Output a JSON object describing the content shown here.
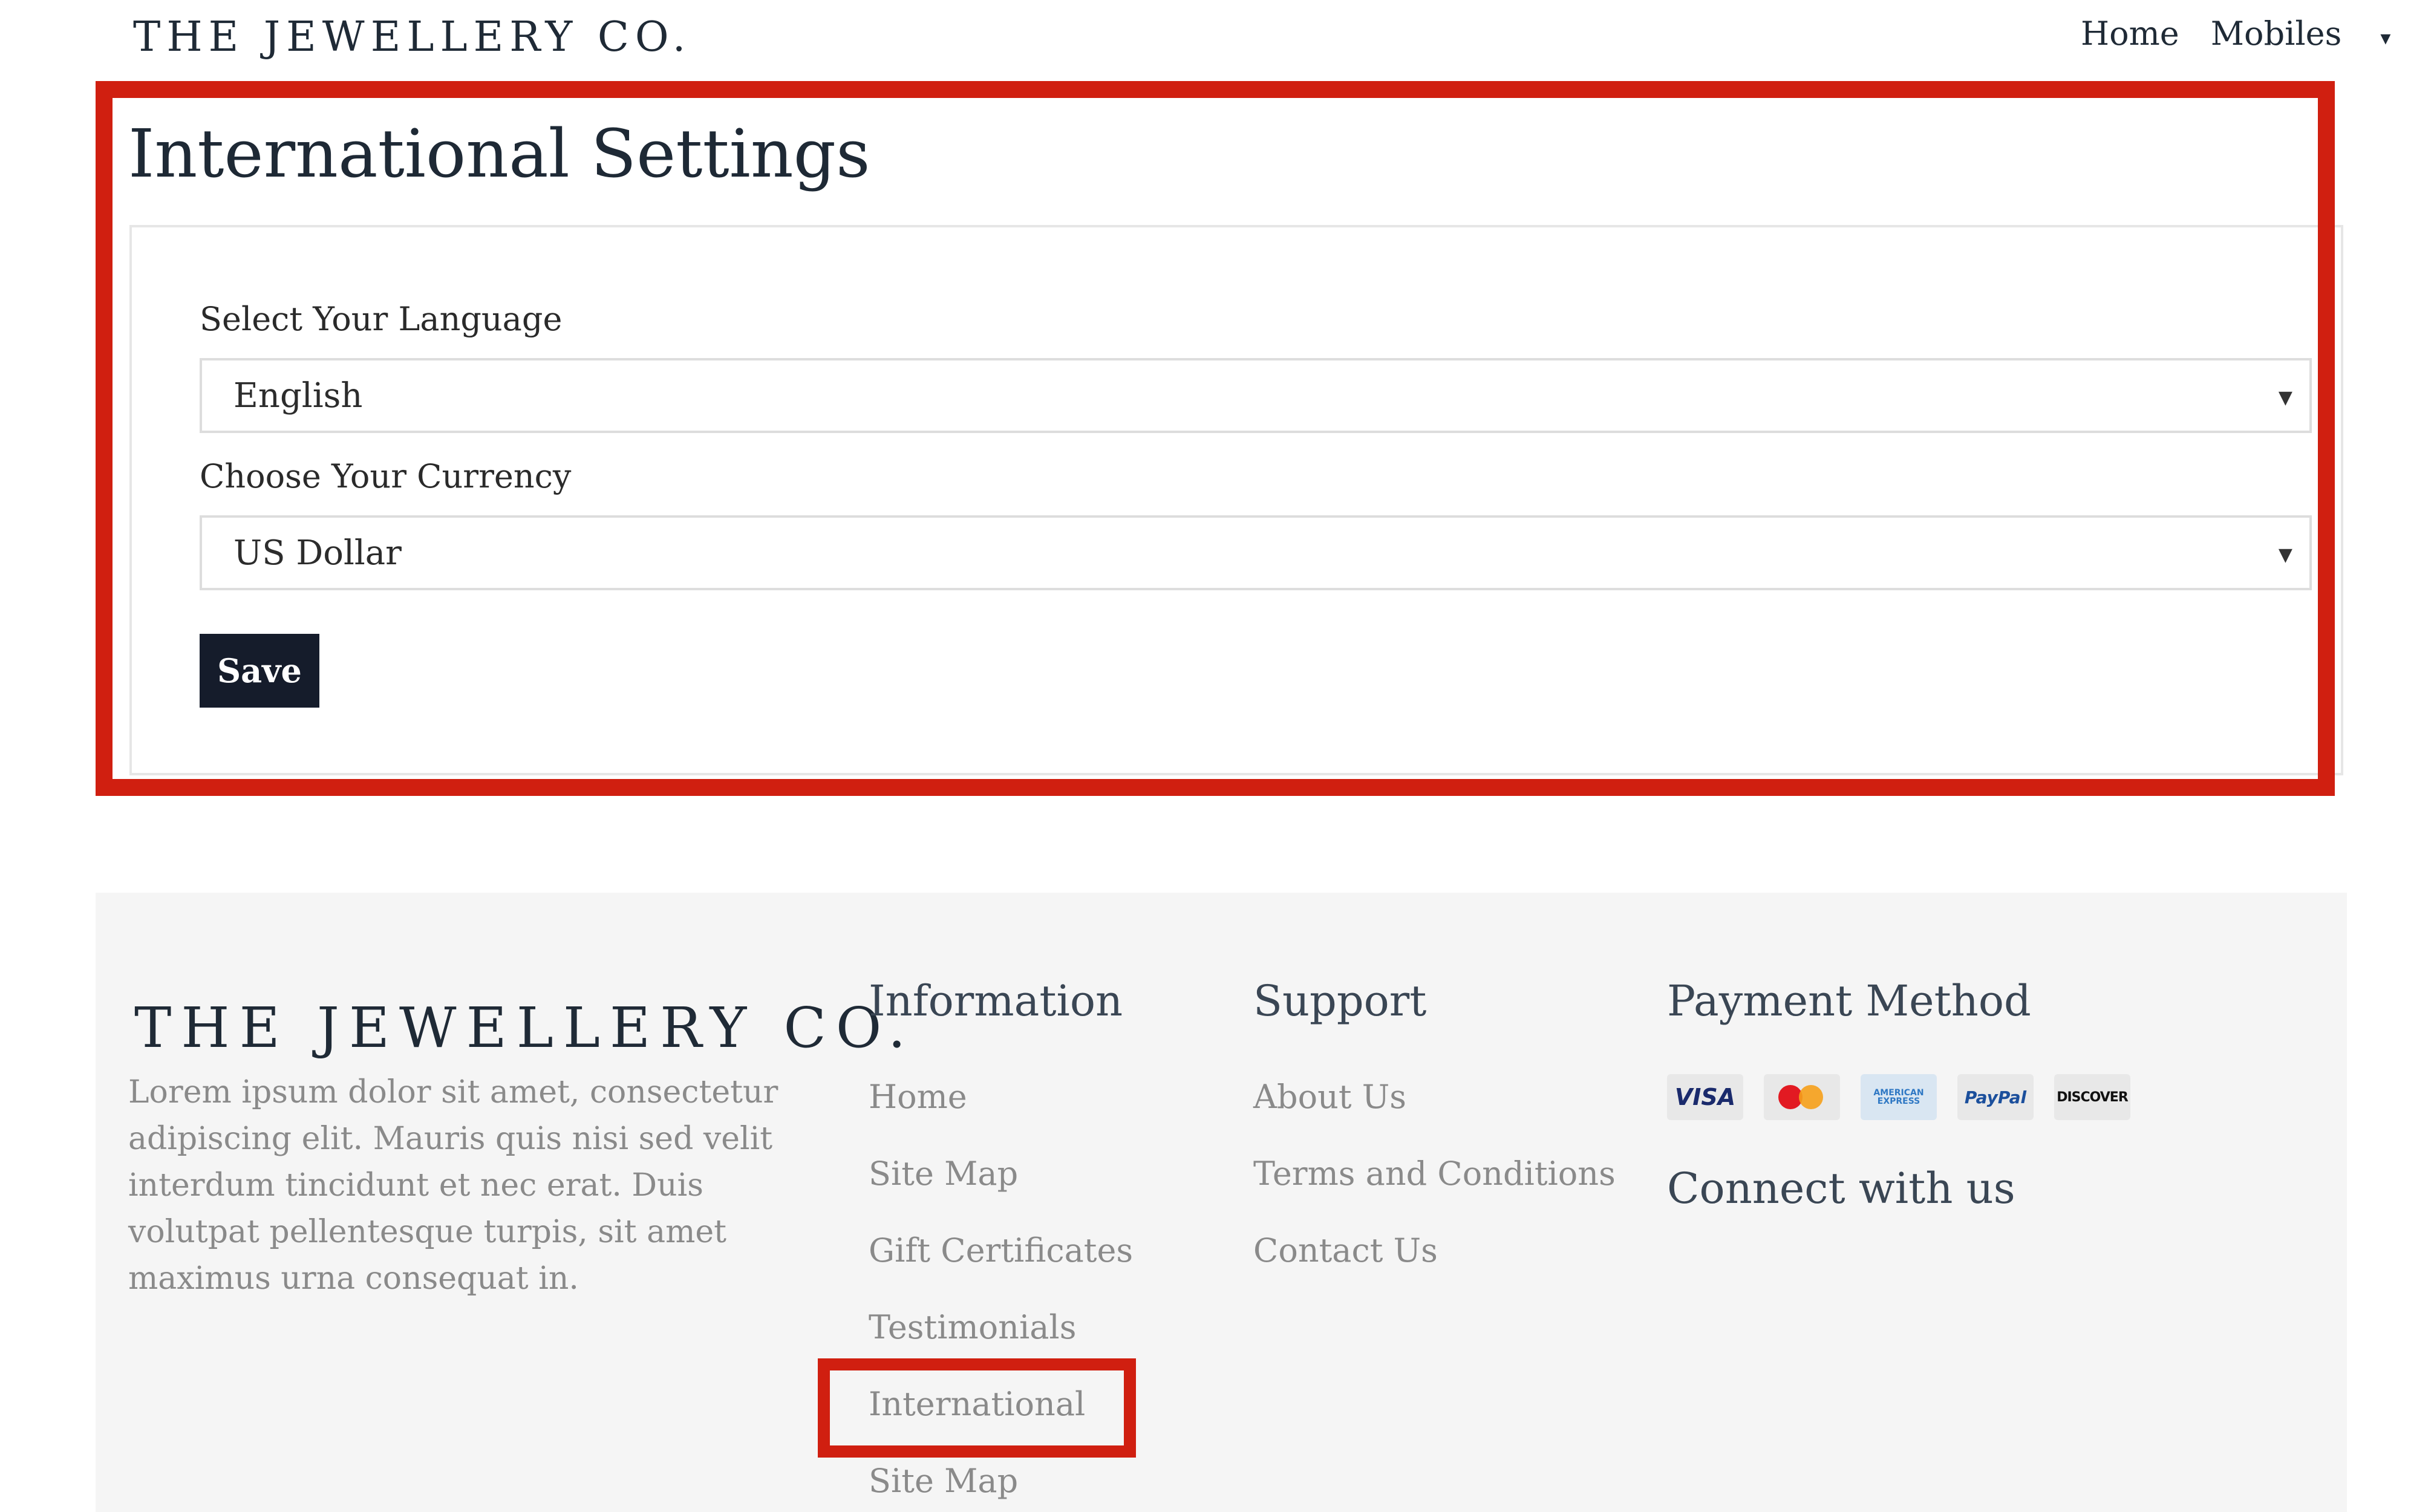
{
  "header": {
    "brand": "THE JEWELLERY CO.",
    "nav": [
      "Home",
      "Mobiles"
    ]
  },
  "settings": {
    "title": "International Settings",
    "language_label": "Select Your Language",
    "language_value": "English",
    "currency_label": "Choose Your Currency",
    "currency_value": "US Dollar",
    "save_label": "Save"
  },
  "footer": {
    "brand": "THE JEWELLERY CO.",
    "description": "Lorem ipsum dolor sit amet, consectetur adipiscing elit. Mauris quis nisi sed velit interdum tincidunt et nec erat. Duis volutpat pellentesque turpis, sit amet maximus urna consequat in.",
    "information": {
      "heading": "Information",
      "links": [
        "Home",
        "Site Map",
        "Gift Certificates",
        "Testimonials",
        "International",
        "Site Map"
      ]
    },
    "support": {
      "heading": "Support",
      "links": [
        "About Us",
        "Terms and Conditions",
        "Contact Us"
      ]
    },
    "payment": {
      "heading": "Payment Method",
      "cards": [
        "VISA",
        "MasterCard",
        "AMERICAN EXPRESS",
        "PayPal",
        "DISCOVER"
      ]
    },
    "connect_heading": "Connect with us"
  },
  "colors": {
    "highlight": "#d01f10",
    "button_bg": "#151c2b",
    "footer_bg": "#f5f5f5"
  }
}
